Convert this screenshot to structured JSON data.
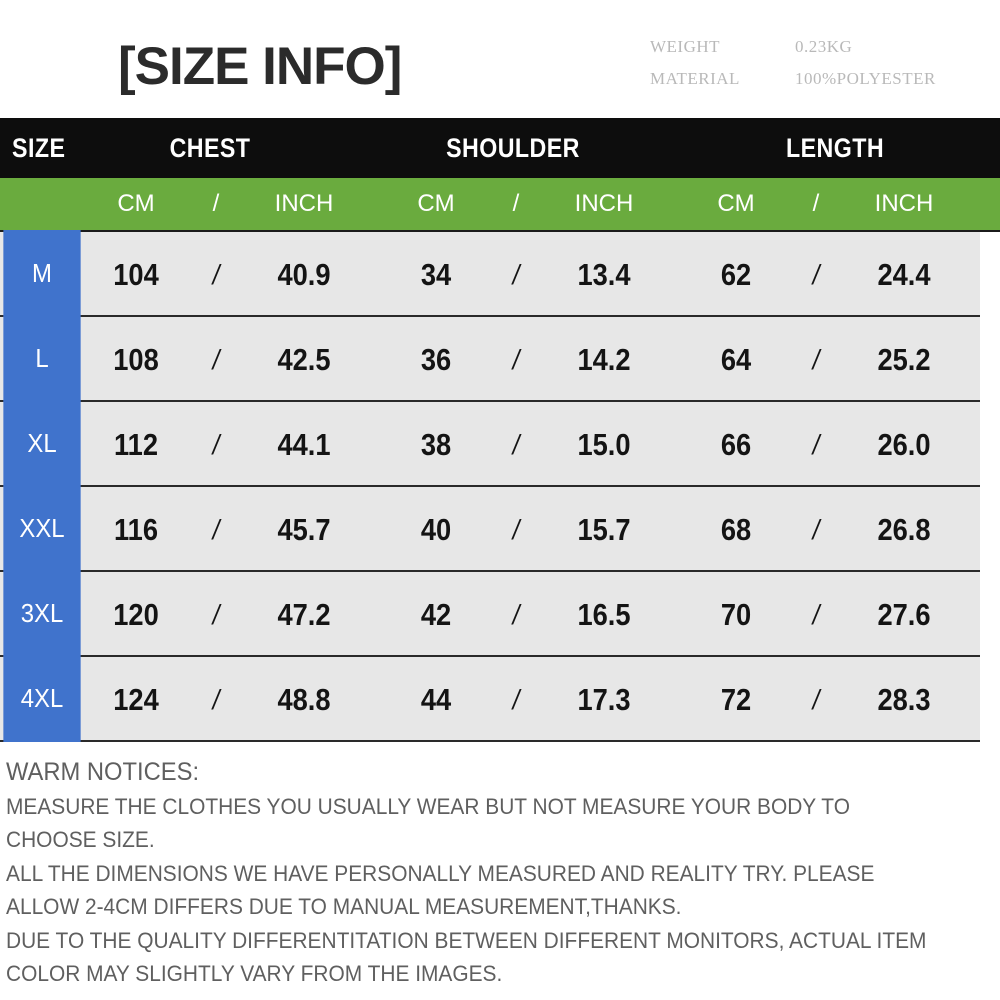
{
  "header": {
    "title": "[SIZE INFO]",
    "specs": [
      {
        "key": "WEIGHT",
        "value": "0.23KG"
      },
      {
        "key": "MATERIAL",
        "value": "100%POLYESTER"
      }
    ]
  },
  "table": {
    "columns": [
      {
        "label": "SIZE"
      },
      {
        "label": "CHEST"
      },
      {
        "label": "SHOULDER"
      },
      {
        "label": "LENGTH"
      }
    ],
    "units": {
      "cm": "CM",
      "separator": "/",
      "inch": "INCH"
    },
    "rows": [
      {
        "size": "M",
        "chest_cm": "104",
        "chest_in": "40.9",
        "shoulder_cm": "34",
        "shoulder_in": "13.4",
        "length_cm": "62",
        "length_in": "24.4"
      },
      {
        "size": "L",
        "chest_cm": "108",
        "chest_in": "42.5",
        "shoulder_cm": "36",
        "shoulder_in": "14.2",
        "length_cm": "64",
        "length_in": "25.2"
      },
      {
        "size": "XL",
        "chest_cm": "112",
        "chest_in": "44.1",
        "shoulder_cm": "38",
        "shoulder_in": "15.0",
        "length_cm": "66",
        "length_in": "26.0"
      },
      {
        "size": "XXL",
        "chest_cm": "116",
        "chest_in": "45.7",
        "shoulder_cm": "40",
        "shoulder_in": "15.7",
        "length_cm": "68",
        "length_in": "26.8"
      },
      {
        "size": "3XL",
        "chest_cm": "120",
        "chest_in": "47.2",
        "shoulder_cm": "42",
        "shoulder_in": "16.5",
        "length_cm": "70",
        "length_in": "27.6"
      },
      {
        "size": "4XL",
        "chest_cm": "124",
        "chest_in": "48.8",
        "shoulder_cm": "44",
        "shoulder_in": "17.3",
        "length_cm": "72",
        "length_in": "28.3"
      }
    ]
  },
  "notices": {
    "title": "WARM NOTICES:",
    "lines": [
      "MEASURE THE CLOTHES YOU USUALLY WEAR BUT NOT MEASURE YOUR BODY TO",
      "CHOOSE SIZE.",
      "ALL THE DIMENSIONS WE HAVE PERSONALLY MEASURED AND REALITY TRY. PLEASE",
      "ALLOW 2-4CM DIFFERS DUE TO MANUAL MEASUREMENT,THANKS.",
      "DUE TO THE QUALITY DIFFERENTITATION BETWEEN DIFFERENT MONITORS, ACTUAL ITEM",
      "COLOR MAY SLIGHTLY VARY FROM THE IMAGES."
    ]
  },
  "colors": {
    "header_bar": "#0d0d0d",
    "unit_bar_green": "#6aab3e",
    "size_cell_blue": "#4073cc",
    "row_background": "#e7e7e7",
    "title_text": "#2b2b2b",
    "notice_text": "#5f5f5f",
    "spec_text": "#b9b9b9"
  }
}
